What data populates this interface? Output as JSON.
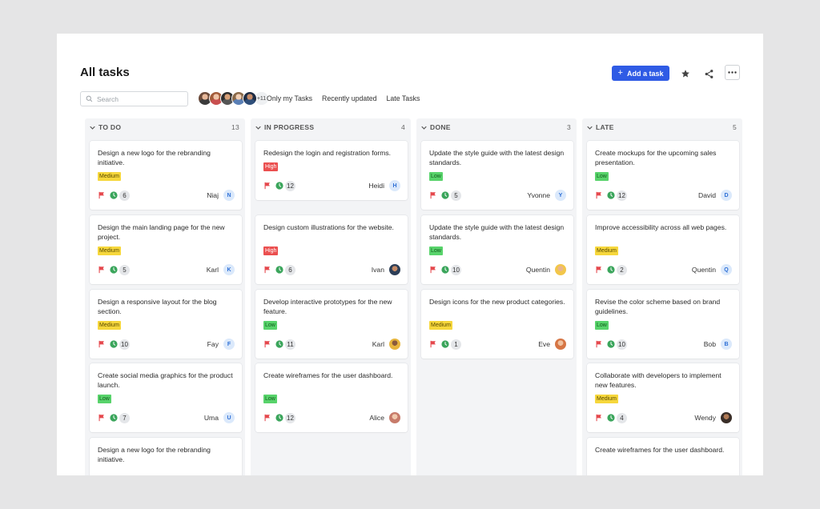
{
  "page": {
    "title": "All tasks",
    "add_task_label": "Add a task",
    "search_placeholder": "Search",
    "avatars_more": "+11",
    "filters": [
      "Only my Tasks",
      "Recently updated",
      "Late Tasks"
    ]
  },
  "colors": {
    "accent": "#2f5be5",
    "medium": "#f6d73c",
    "high": "#eb4f4f",
    "low": "#58d36b",
    "flag": "#e5484d",
    "clock": "#3aa55b"
  },
  "columns": [
    {
      "name": "TO DO",
      "count": "13",
      "cards": [
        {
          "title": "Design a new logo for the rebranding initiative.",
          "priority": "Medium",
          "num": "6",
          "assignee": "Niaj",
          "initial": "N"
        },
        {
          "title": "Design the main landing page for the new project.",
          "priority": "Medium",
          "num": "5",
          "assignee": "Karl",
          "initial": "K"
        },
        {
          "title": "Design a responsive layout for the blog section.",
          "priority": "Medium",
          "num": "10",
          "assignee": "Fay",
          "initial": "F"
        },
        {
          "title": "Create social media graphics for the product launch.",
          "priority": "Low",
          "num": "7",
          "assignee": "Uma",
          "initial": "U"
        },
        {
          "title": "Design a new logo for the rebranding initiative.",
          "priority": "",
          "num": "",
          "assignee": "",
          "initial": ""
        }
      ]
    },
    {
      "name": "IN PROGRESS",
      "count": "4",
      "cards": [
        {
          "title": "Redesign the login and registration forms.",
          "priority": "High",
          "num": "12",
          "assignee": "Heidi",
          "initial": "H"
        },
        {
          "title": "Design custom illustrations for the website.",
          "priority": "High",
          "num": "6",
          "assignee": "Ivan",
          "initial": ""
        },
        {
          "title": "Develop interactive prototypes for the new feature.",
          "priority": "Low",
          "num": "11",
          "assignee": "Karl",
          "initial": ""
        },
        {
          "title": "Create wireframes for the user dashboard.",
          "priority": "Low",
          "num": "12",
          "assignee": "Alice",
          "initial": ""
        }
      ]
    },
    {
      "name": "DONE",
      "count": "3",
      "cards": [
        {
          "title": "Update the style guide with the latest design standards.",
          "priority": "Low",
          "num": "5",
          "assignee": "Yvonne",
          "initial": "Y"
        },
        {
          "title": "Update the style guide with the latest design standards.",
          "priority": "Low",
          "num": "10",
          "assignee": "Quentin",
          "initial": ""
        },
        {
          "title": "Design icons for the new product categories.",
          "priority": "Medium",
          "num": "1",
          "assignee": "Eve",
          "initial": ""
        }
      ]
    },
    {
      "name": "LATE",
      "count": "5",
      "cards": [
        {
          "title": "Create mockups for the upcoming sales presentation.",
          "priority": "Low",
          "num": "12",
          "assignee": "David",
          "initial": "D"
        },
        {
          "title": "Improve accessibility across all web pages.",
          "priority": "Medium",
          "num": "2",
          "assignee": "Quentin",
          "initial": "Q"
        },
        {
          "title": "Revise the color scheme based on brand guidelines.",
          "priority": "Low",
          "num": "10",
          "assignee": "Bob",
          "initial": "B"
        },
        {
          "title": "Collaborate with developers to implement new features.",
          "priority": "Medium",
          "num": "4",
          "assignee": "Wendy",
          "initial": ""
        },
        {
          "title": "Create wireframes for the user dashboard.",
          "priority": "",
          "num": "",
          "assignee": "",
          "initial": ""
        }
      ]
    }
  ]
}
